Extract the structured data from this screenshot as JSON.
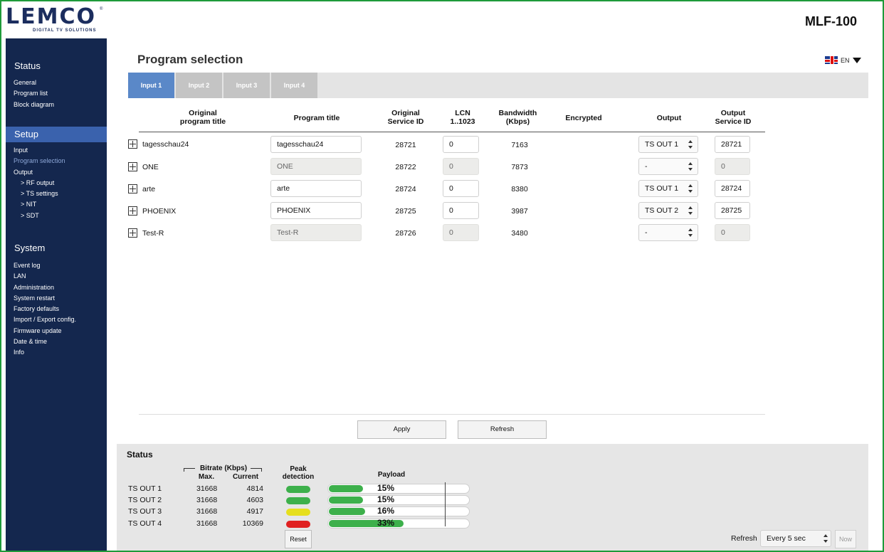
{
  "header": {
    "logo_text": "LEMCO",
    "logo_reg": "®",
    "logo_sub": "DIGITAL TV SOLUTIONS",
    "model": "MLF-100"
  },
  "sidebar": {
    "status": {
      "title": "Status",
      "items": [
        "General",
        "Program list",
        "Block diagram"
      ]
    },
    "setup": {
      "title": "Setup",
      "items": [
        "Input",
        "Program selection",
        "Output",
        "> RF output",
        "> TS settings",
        "> NIT",
        "> SDT"
      ]
    },
    "system": {
      "title": "System",
      "items": [
        "Event log",
        "LAN",
        "Administration",
        "System restart",
        "Factory defaults",
        "Import / Export config.",
        "Firmware update",
        "Date & time",
        "Info"
      ]
    }
  },
  "page": {
    "title": "Program selection",
    "language": "EN"
  },
  "tabs": [
    "Input 1",
    "Input 2",
    "Input 3",
    "Input 4"
  ],
  "table": {
    "headers": {
      "orig_title": "Original\nprogram title",
      "prog_title": "Program title",
      "service_id": "Original\nService ID",
      "lcn": "LCN\n1..1023",
      "bandwidth": "Bandwidth\n(Kbps)",
      "encrypted": "Encrypted",
      "output": "Output",
      "out_sid": "Output\nService ID"
    },
    "rows": [
      {
        "orig": "tagesschau24",
        "title": "tagesschau24",
        "sid": "28721",
        "lcn": "0",
        "bw": "7163",
        "encrypted": "",
        "output": "TS OUT 1",
        "out_sid": "28721",
        "enabled": true
      },
      {
        "orig": "ONE",
        "title": "ONE",
        "sid": "28722",
        "lcn": "0",
        "bw": "7873",
        "encrypted": "",
        "output": "-",
        "out_sid": "0",
        "enabled": false
      },
      {
        "orig": "arte",
        "title": "arte",
        "sid": "28724",
        "lcn": "0",
        "bw": "8380",
        "encrypted": "",
        "output": "TS OUT 1",
        "out_sid": "28724",
        "enabled": true
      },
      {
        "orig": "PHOENIX",
        "title": "PHOENIX",
        "sid": "28725",
        "lcn": "0",
        "bw": "3987",
        "encrypted": "",
        "output": "TS OUT 2",
        "out_sid": "28725",
        "enabled": true
      },
      {
        "orig": "Test-R",
        "title": "Test-R",
        "sid": "28726",
        "lcn": "0",
        "bw": "3480",
        "encrypted": "",
        "output": "-",
        "out_sid": "0",
        "enabled": false
      }
    ]
  },
  "buttons": {
    "apply": "Apply",
    "refresh": "Refresh",
    "reset": "Reset",
    "now": "Now"
  },
  "status": {
    "title": "Status",
    "bitrate_label": "Bitrate (Kbps)",
    "max_label": "Max.",
    "current_label": "Current",
    "peak_label": "Peak\ndetection",
    "payload_label": "Payload",
    "outputs": [
      {
        "name": "TS OUT 1",
        "max": "31668",
        "current": "4814",
        "peak_color": "#3db04b",
        "payload": "15%",
        "payload_value": 0.15
      },
      {
        "name": "TS OUT 2",
        "max": "31668",
        "current": "4603",
        "peak_color": "#3db04b",
        "payload": "15%",
        "payload_value": 0.15
      },
      {
        "name": "TS OUT 3",
        "max": "31668",
        "current": "4917",
        "peak_color": "#e6df1e",
        "payload": "16%",
        "payload_value": 0.16
      },
      {
        "name": "TS OUT 4",
        "max": "31668",
        "current": "10369",
        "peak_color": "#e02020",
        "payload": "33%",
        "payload_value": 0.33
      }
    ]
  },
  "refresh": {
    "label": "Refresh",
    "interval": "Every 5 sec"
  }
}
